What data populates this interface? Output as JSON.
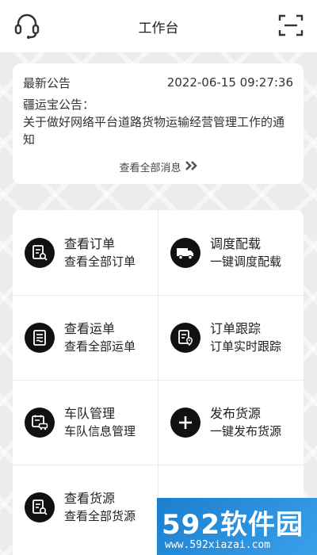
{
  "header": {
    "title": "工作台",
    "left_icon": "headset-icon",
    "right_icon": "scan-icon"
  },
  "notice": {
    "label": "最新公告",
    "datetime": "2022-06-15 09:27:36",
    "line1": "疆运宝公告：",
    "line2": "关于做好网络平台道路货物运输经营管理工作的通知",
    "more": "查看全部消息",
    "more_icon": "double-chevron-right-icon"
  },
  "grid": {
    "items": [
      {
        "title": "查看订单",
        "sub": "查看全部订单",
        "icon": "order-list-icon"
      },
      {
        "title": "调度配载",
        "sub": "一键调度配载",
        "icon": "truck-icon"
      },
      {
        "title": "查看运单",
        "sub": "查看全部运单",
        "icon": "waybill-icon"
      },
      {
        "title": "订单跟踪",
        "sub": "订单实时跟踪",
        "icon": "order-tracking-icon"
      },
      {
        "title": "车队管理",
        "sub": "车队信息管理",
        "icon": "fleet-icon"
      },
      {
        "title": "发布货源",
        "sub": "一键发布货源",
        "icon": "plus-icon"
      },
      {
        "title": "查看货源",
        "sub": "查看全部货源",
        "icon": "cargo-search-icon"
      }
    ]
  },
  "watermark": {
    "brand": "592软件园",
    "url": "www.592xiazai.com"
  },
  "colors": {
    "icon_bg": "#111111",
    "page_bg": "#ececec",
    "watermark_bg": "#1a7fd0"
  }
}
